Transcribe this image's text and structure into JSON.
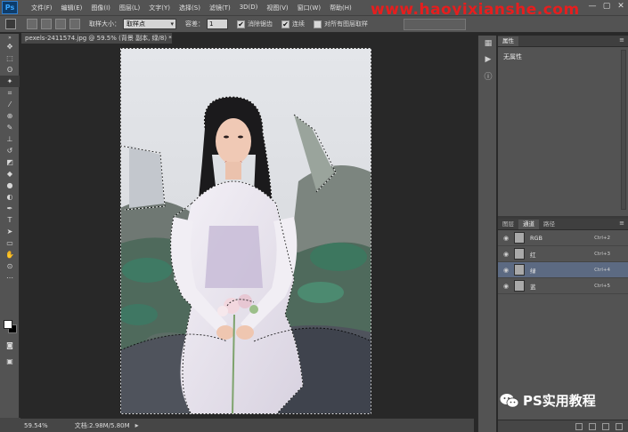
{
  "app": {
    "logo": "Ps",
    "menus": [
      "文件(F)",
      "编辑(E)",
      "图像(I)",
      "图层(L)",
      "文字(Y)",
      "选择(S)",
      "滤镜(T)",
      "3D(D)",
      "视图(V)",
      "窗口(W)",
      "帮助(H)"
    ],
    "watermark": "www.haoyixianshe.com",
    "win_controls": [
      "—",
      "▢",
      "✕"
    ]
  },
  "options_bar": {
    "tool_icon": "magic-wand-icon",
    "sample_size_label": "取样大小：",
    "sample_size_value": "取样点",
    "tolerance_label": "容差：",
    "tolerance_value": "1",
    "antialias_label": "消除锯齿",
    "antialias_checked": "✔",
    "contiguous_label": "连续",
    "contiguous_checked": "✔",
    "sample_all_label": "对所有图层取样"
  },
  "document": {
    "tab_title": "pexels-2411574.jpg @ 59.5% (背景 副本, 绿/8) *",
    "tab_close": "×"
  },
  "status_bar": {
    "zoom": "59.54%",
    "doc_info": "文档:2.98M/5.80M",
    "arrow": "▸"
  },
  "properties_panel": {
    "tab": "属性",
    "content": "无属性",
    "menu_icon": "≡"
  },
  "channels_panel": {
    "tabs": [
      "图层",
      "通道",
      "路径"
    ],
    "active_tab": "通道",
    "menu_icon": "≡",
    "channels": [
      {
        "name": "RGB",
        "shortcut": "Ctrl+2",
        "selected": false
      },
      {
        "name": "红",
        "shortcut": "Ctrl+3",
        "selected": false
      },
      {
        "name": "绿",
        "shortcut": "Ctrl+4",
        "selected": true
      },
      {
        "name": "蓝",
        "shortcut": "Ctrl+5",
        "selected": false
      }
    ],
    "eye_icon": "◉"
  },
  "brand": {
    "text": "PS实用教程",
    "icon": "wechat-icon"
  },
  "colors": {
    "foreground": "#ffffff",
    "background": "#000000",
    "selected_row": "#5c6a82",
    "watermark": "#e61e1e"
  }
}
